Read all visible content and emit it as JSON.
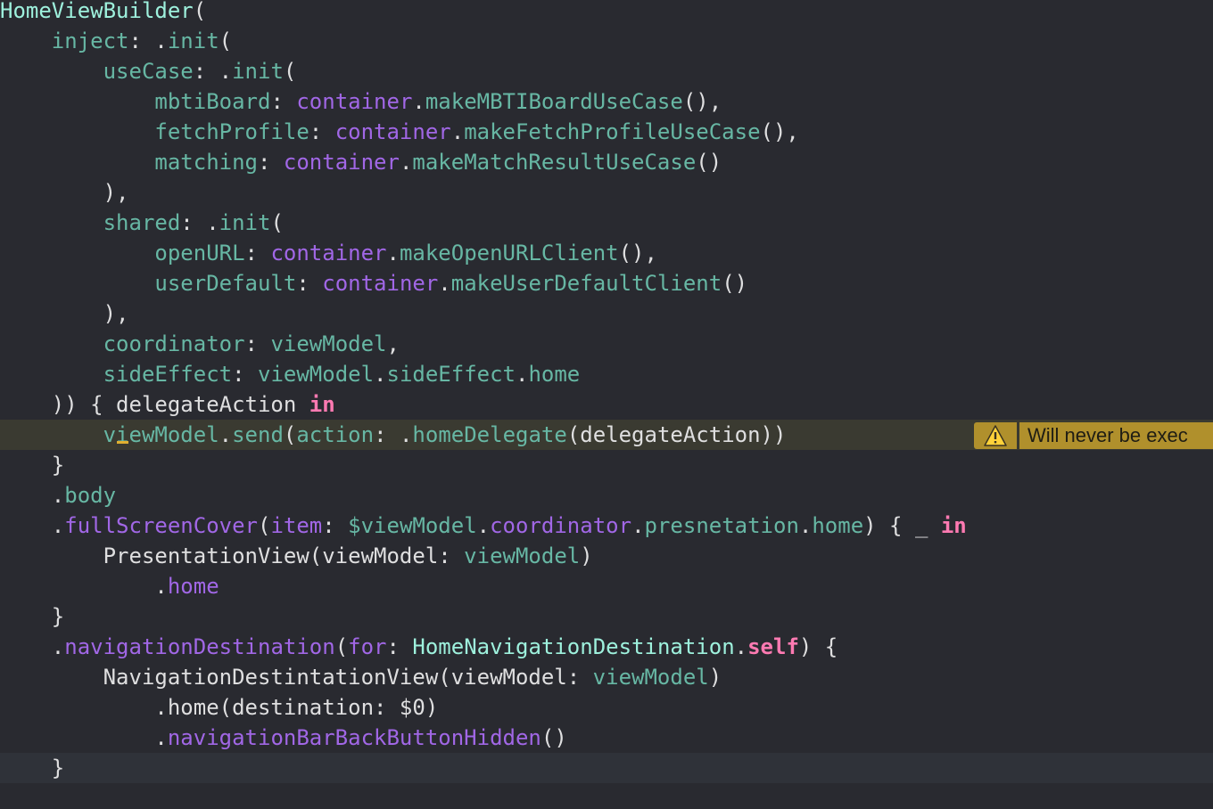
{
  "colors": {
    "background": "#292a30",
    "plain": "#dfdfe0",
    "identifier": "#67b7a4",
    "member": "#a167e6",
    "type": "#9ef1dd",
    "keyword": "#ff7ab2",
    "warning_line": "#3a3a31",
    "current_line": "#2f3239",
    "warning_badge": "#b0902c"
  },
  "warning": {
    "icon": "warning-triangle-icon",
    "message": "Will never be exec"
  },
  "lines": [
    {
      "tokens": [
        [
          "HomeViewBuilder",
          "type"
        ],
        [
          "(",
          "plain"
        ]
      ]
    },
    {
      "tokens": [
        [
          "    ",
          "plain"
        ],
        [
          "inject",
          "identifier"
        ],
        [
          ": .",
          "plain"
        ],
        [
          "init",
          "identifier"
        ],
        [
          "(",
          "plain"
        ]
      ]
    },
    {
      "tokens": [
        [
          "        ",
          "plain"
        ],
        [
          "useCase",
          "identifier"
        ],
        [
          ": .",
          "plain"
        ],
        [
          "init",
          "identifier"
        ],
        [
          "(",
          "plain"
        ]
      ]
    },
    {
      "tokens": [
        [
          "            ",
          "plain"
        ],
        [
          "mbtiBoard",
          "identifier"
        ],
        [
          ": ",
          "plain"
        ],
        [
          "container",
          "member"
        ],
        [
          ".",
          "plain"
        ],
        [
          "makeMBTIBoardUseCase",
          "identifier"
        ],
        [
          "(),",
          "plain"
        ]
      ]
    },
    {
      "tokens": [
        [
          "            ",
          "plain"
        ],
        [
          "fetchProfile",
          "identifier"
        ],
        [
          ": ",
          "plain"
        ],
        [
          "container",
          "member"
        ],
        [
          ".",
          "plain"
        ],
        [
          "makeFetchProfileUseCase",
          "identifier"
        ],
        [
          "(),",
          "plain"
        ]
      ]
    },
    {
      "tokens": [
        [
          "            ",
          "plain"
        ],
        [
          "matching",
          "identifier"
        ],
        [
          ": ",
          "plain"
        ],
        [
          "container",
          "member"
        ],
        [
          ".",
          "plain"
        ],
        [
          "makeMatchResultUseCase",
          "identifier"
        ],
        [
          "()",
          "plain"
        ]
      ]
    },
    {
      "tokens": [
        [
          "        ),",
          "plain"
        ]
      ]
    },
    {
      "tokens": [
        [
          "        ",
          "plain"
        ],
        [
          "shared",
          "identifier"
        ],
        [
          ": .",
          "plain"
        ],
        [
          "init",
          "identifier"
        ],
        [
          "(",
          "plain"
        ]
      ]
    },
    {
      "tokens": [
        [
          "            ",
          "plain"
        ],
        [
          "openURL",
          "identifier"
        ],
        [
          ": ",
          "plain"
        ],
        [
          "container",
          "member"
        ],
        [
          ".",
          "plain"
        ],
        [
          "makeOpenURLClient",
          "identifier"
        ],
        [
          "(),",
          "plain"
        ]
      ]
    },
    {
      "tokens": [
        [
          "            ",
          "plain"
        ],
        [
          "userDefault",
          "identifier"
        ],
        [
          ": ",
          "plain"
        ],
        [
          "container",
          "member"
        ],
        [
          ".",
          "plain"
        ],
        [
          "makeUserDefaultClient",
          "identifier"
        ],
        [
          "()",
          "plain"
        ]
      ]
    },
    {
      "tokens": [
        [
          "        ),",
          "plain"
        ]
      ]
    },
    {
      "tokens": [
        [
          "        ",
          "plain"
        ],
        [
          "coordinator",
          "identifier"
        ],
        [
          ": ",
          "plain"
        ],
        [
          "viewModel",
          "identifier"
        ],
        [
          ",",
          "plain"
        ]
      ]
    },
    {
      "tokens": [
        [
          "        ",
          "plain"
        ],
        [
          "sideEffect",
          "identifier"
        ],
        [
          ": ",
          "plain"
        ],
        [
          "viewModel",
          "identifier"
        ],
        [
          ".",
          "plain"
        ],
        [
          "sideEffect",
          "identifier"
        ],
        [
          ".",
          "plain"
        ],
        [
          "home",
          "identifier"
        ]
      ]
    },
    {
      "tokens": [
        [
          "    )) { delegateAction ",
          "plain"
        ],
        [
          "in",
          "keyword"
        ]
      ]
    },
    {
      "tokens": [
        [
          "        ",
          "plain"
        ],
        [
          "v",
          "identifier"
        ],
        [
          "i",
          "caret"
        ],
        [
          "ewModel",
          "identifier"
        ],
        [
          ".",
          "plain"
        ],
        [
          "send",
          "identifier"
        ],
        [
          "(",
          "plain"
        ],
        [
          "action",
          "identifier"
        ],
        [
          ": .",
          "plain"
        ],
        [
          "homeDelegate",
          "identifier"
        ],
        [
          "(delegateAction))",
          "plain"
        ]
      ],
      "warning": true
    },
    {
      "tokens": [
        [
          "    }",
          "plain"
        ]
      ]
    },
    {
      "tokens": [
        [
          "    .",
          "plain"
        ],
        [
          "body",
          "identifier"
        ]
      ]
    },
    {
      "tokens": [
        [
          "    .",
          "plain"
        ],
        [
          "fullScreenCover",
          "member"
        ],
        [
          "(",
          "plain"
        ],
        [
          "item",
          "member"
        ],
        [
          ": ",
          "plain"
        ],
        [
          "$viewModel",
          "identifier"
        ],
        [
          ".",
          "plain"
        ],
        [
          "coordinator",
          "member"
        ],
        [
          ".",
          "plain"
        ],
        [
          "presnetation",
          "identifier"
        ],
        [
          ".",
          "plain"
        ],
        [
          "home",
          "identifier"
        ],
        [
          ") { _ ",
          "plain"
        ],
        [
          "in",
          "keyword"
        ]
      ]
    },
    {
      "tokens": [
        [
          "        PresentationView(viewModel: ",
          "plain"
        ],
        [
          "viewModel",
          "identifier"
        ],
        [
          ")",
          "plain"
        ]
      ]
    },
    {
      "tokens": [
        [
          "            .",
          "plain"
        ],
        [
          "home",
          "member"
        ]
      ]
    },
    {
      "tokens": [
        [
          "    }",
          "plain"
        ]
      ]
    },
    {
      "tokens": [
        [
          "    .",
          "plain"
        ],
        [
          "navigationDestination",
          "member"
        ],
        [
          "(",
          "plain"
        ],
        [
          "for",
          "member"
        ],
        [
          ": ",
          "plain"
        ],
        [
          "HomeNavigationDestination",
          "type"
        ],
        [
          ".",
          "plain"
        ],
        [
          "self",
          "keyword"
        ],
        [
          ") {",
          "plain"
        ]
      ]
    },
    {
      "tokens": [
        [
          "        NavigationDestintationView(viewModel: ",
          "plain"
        ],
        [
          "viewModel",
          "identifier"
        ],
        [
          ")",
          "plain"
        ]
      ]
    },
    {
      "tokens": [
        [
          "            .home(destination: $0)",
          "plain"
        ]
      ]
    },
    {
      "tokens": [
        [
          "            .",
          "plain"
        ],
        [
          "navigationBarBackButtonHidden",
          "member"
        ],
        [
          "()",
          "plain"
        ]
      ]
    },
    {
      "tokens": [
        [
          "    }",
          "plain"
        ]
      ],
      "current": true
    }
  ]
}
